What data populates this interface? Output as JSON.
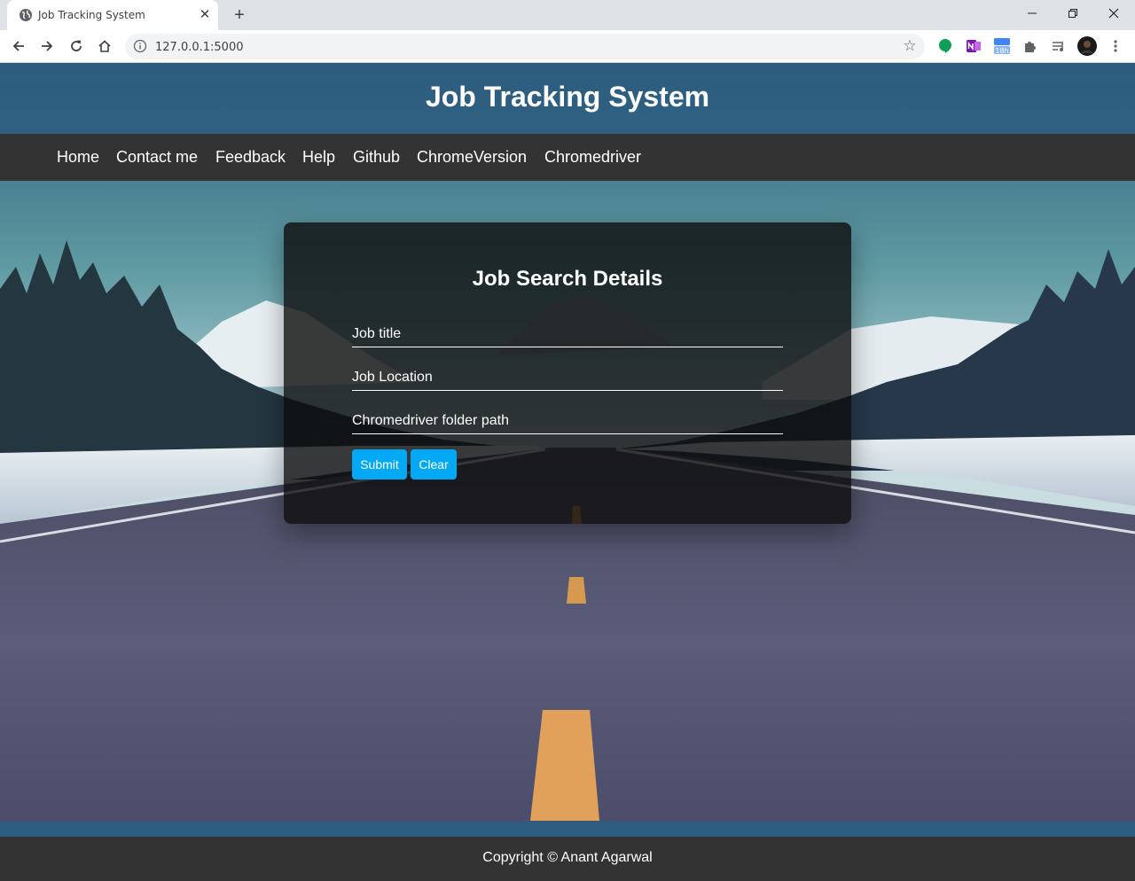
{
  "browser": {
    "tab": {
      "title": "Job Tracking System",
      "favicon": "globe-icon",
      "close": "✕"
    },
    "new_tab": "+",
    "window_controls": [
      "minimize-icon",
      "restore-icon",
      "close-icon"
    ],
    "nav_buttons": [
      "back-arrow-icon",
      "forward-arrow-icon",
      "reload-icon",
      "home-icon"
    ],
    "address": {
      "url": "127.0.0.1:5000",
      "site_info": "info-icon",
      "bookmark": "star-icon"
    },
    "extensions": [
      {
        "name": "hangouts-extension-icon",
        "color": "#0f9d58"
      },
      {
        "name": "onenote-extension-icon",
        "color": "#7719aa"
      },
      {
        "name": "timer-extension-icon",
        "color": "#4285f4",
        "badge": "18h"
      },
      {
        "name": "puzzle-extensions-icon",
        "color": "#5f6368"
      },
      {
        "name": "media-queue-icon",
        "color": "#5f6368"
      },
      {
        "name": "profile-avatar",
        "color": "#1a1a1a"
      },
      {
        "name": "menu-kebab-icon",
        "color": "#5f6368"
      }
    ]
  },
  "page": {
    "header": {
      "title": "Job Tracking System"
    },
    "nav": [
      "Home",
      "Contact me",
      "Feedback",
      "Help",
      "Github",
      "ChromeVersion",
      "Chromedriver"
    ],
    "form": {
      "title": "Job Search Details",
      "fields": [
        {
          "placeholder": "Job title",
          "value": ""
        },
        {
          "placeholder": "Job Location",
          "value": ""
        },
        {
          "placeholder": "Chromedriver folder path",
          "value": ""
        }
      ],
      "buttons": {
        "submit": "Submit",
        "clear": "Clear"
      }
    },
    "footer": {
      "text": "Copyright © Anant Agarwal"
    }
  },
  "colors": {
    "header_bg": "#2c5c80",
    "nav_bg": "#333333",
    "button_bg": "#03a9f4",
    "footer_bg": "#333333"
  }
}
